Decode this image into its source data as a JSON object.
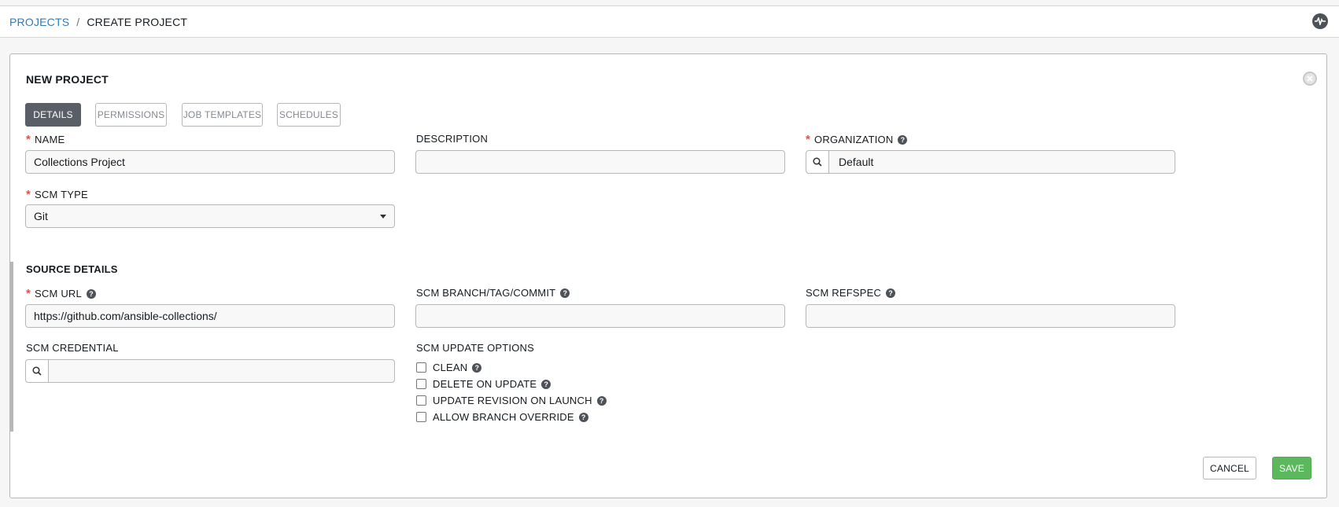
{
  "breadcrumb": {
    "projects": "PROJECTS",
    "separator": "/",
    "current": "CREATE PROJECT"
  },
  "panel": {
    "title": "NEW PROJECT"
  },
  "tabs": [
    {
      "label": "DETAILS",
      "active": true
    },
    {
      "label": "PERMISSIONS",
      "active": false
    },
    {
      "label": "JOB TEMPLATES",
      "active": false
    },
    {
      "label": "SCHEDULES",
      "active": false
    }
  ],
  "fields": {
    "name": {
      "label": "NAME",
      "value": "Collections Project",
      "required": true
    },
    "description": {
      "label": "DESCRIPTION",
      "value": ""
    },
    "organization": {
      "label": "ORGANIZATION",
      "value": "Default",
      "required": true
    },
    "scm_type": {
      "label": "SCM TYPE",
      "value": "Git",
      "required": true
    }
  },
  "source_details": {
    "title": "SOURCE DETAILS",
    "scm_url": {
      "label": "SCM URL",
      "value": "https://github.com/ansible-collections/",
      "required": true
    },
    "scm_branch": {
      "label": "SCM BRANCH/TAG/COMMIT",
      "value": ""
    },
    "scm_refspec": {
      "label": "SCM REFSPEC",
      "value": ""
    },
    "scm_credential": {
      "label": "SCM CREDENTIAL",
      "value": ""
    },
    "update_options": {
      "label": "SCM UPDATE OPTIONS",
      "options": [
        {
          "label": "CLEAN",
          "checked": false
        },
        {
          "label": "DELETE ON UPDATE",
          "checked": false
        },
        {
          "label": "UPDATE REVISION ON LAUNCH",
          "checked": false
        },
        {
          "label": "ALLOW BRANCH OVERRIDE",
          "checked": false
        }
      ]
    }
  },
  "actions": {
    "cancel": "CANCEL",
    "save": "SAVE"
  },
  "icons": {
    "help": "?",
    "required": "*"
  },
  "colors": {
    "link": "#337ab7",
    "required": "#d9534f",
    "save": "#5cb85c",
    "active_tab": "#5a5f67"
  }
}
